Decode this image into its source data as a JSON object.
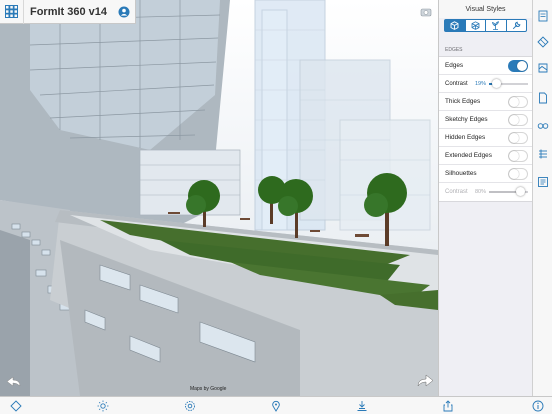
{
  "app": {
    "title": "FormIt 360 v14"
  },
  "viewport": {
    "map_attribution": "Maps by Google"
  },
  "panel": {
    "title": "Visual Styles",
    "section_label": "EDGES",
    "rows": {
      "edges": {
        "label": "Edges",
        "on": true
      },
      "thick_edges": {
        "label": "Thick Edges",
        "on": false
      },
      "sketchy_edges": {
        "label": "Sketchy Edges",
        "on": false
      },
      "hidden_edges": {
        "label": "Hidden Edges",
        "on": false
      },
      "extended_edges": {
        "label": "Extended Edges",
        "on": false
      },
      "silhouettes": {
        "label": "Silhouettes",
        "on": false
      }
    },
    "contrast_edges": {
      "label": "Contrast",
      "value": "19%",
      "level": 0.19
    },
    "contrast_silhouettes": {
      "label": "Contrast",
      "value": "80%",
      "level": 0.8,
      "disabled": true
    }
  },
  "colors": {
    "accent": "#2a7ab8",
    "grass": "#3f6b2a",
    "tree": "#2e6a1e"
  },
  "icons": {
    "title_left": "grid-icon",
    "title_right": "user-icon",
    "tabs": [
      "cube-icon",
      "wireframe-icon",
      "plant-icon",
      "wrench-icon"
    ],
    "side": [
      "layers-icon",
      "materials-icon",
      "scenes-icon",
      "vr-glasses-icon",
      "levels-icon",
      "properties-icon"
    ],
    "bottom": [
      "sketch-icon",
      "sun-icon",
      "settings-icon",
      "location-icon",
      "analysis-icon",
      "share-icon",
      "info-icon"
    ]
  }
}
